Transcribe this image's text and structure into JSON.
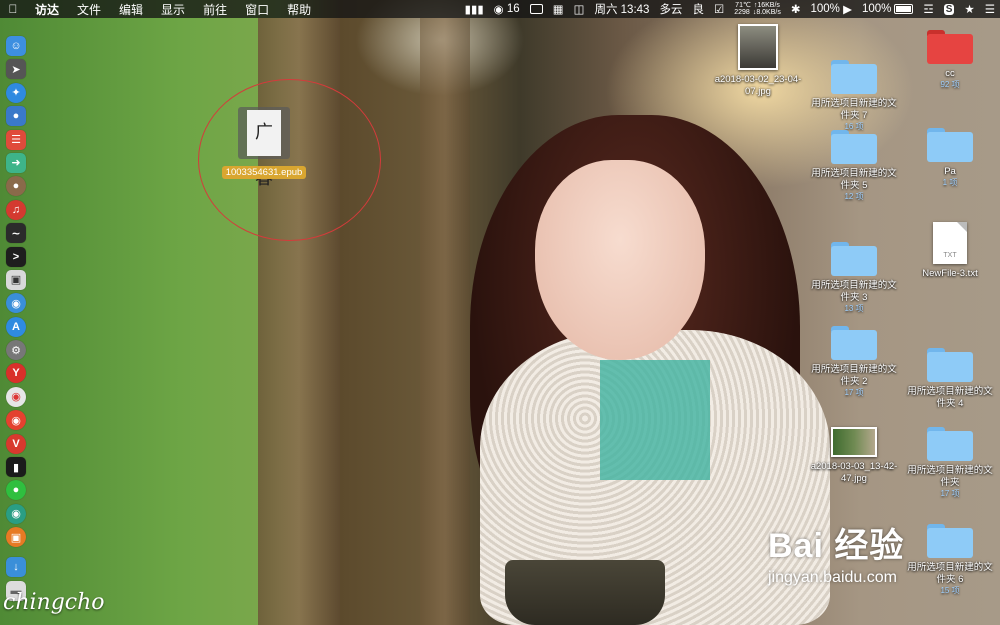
{
  "menubar": {
    "app_name": "访达",
    "menus": [
      "文件",
      "编辑",
      "显示",
      "前往",
      "窗口",
      "帮助"
    ],
    "status": {
      "wechat_count": "16",
      "datetime": "周六 13:43",
      "weather": "多云",
      "quality": "良",
      "temperature": "71℃",
      "net_up": "↑16KB/s",
      "fan": "2298",
      "net_down": "↓8.0KB/s",
      "volume": "100%",
      "battery": "100%"
    }
  },
  "desktop": {
    "epub": {
      "label": "1003354631.epub",
      "cover_text": "广春"
    },
    "jpg1": {
      "label": "a2018-03-02_23-04-07.jpg"
    },
    "jpg2": {
      "label": "a2018-03-03_13-42-47.jpg"
    },
    "folders": [
      {
        "name": "cc",
        "count": "92 项",
        "color": "red"
      },
      {
        "name": "用所选项目新建的文件夹 7",
        "count": "16 项",
        "color": "blue"
      },
      {
        "name": "Pa",
        "count": "1 项",
        "color": "blue"
      },
      {
        "name": "用所选项目新建的文件夹 5",
        "count": "12 项",
        "color": "blue"
      },
      {
        "name": "用所选项目新建的文件夹 3",
        "count": "13 项",
        "color": "blue"
      },
      {
        "name": "用所选项目新建的文件夹 2",
        "count": "17 项",
        "color": "blue"
      },
      {
        "name": "用所选项目新建的文件夹 4",
        "count": "",
        "color": "blue"
      },
      {
        "name": "用所选项目新建的文件夹",
        "count": "17 项",
        "color": "blue"
      },
      {
        "name": "用所选项目新建的文件夹 6",
        "count": "15 项",
        "color": "blue"
      }
    ],
    "txt": {
      "name": "NewFile-3.txt",
      "badge": "TXT"
    }
  },
  "dock": [
    {
      "name": "finder",
      "color": "#3d8fe0"
    },
    {
      "name": "launchpad",
      "color": "#555"
    },
    {
      "name": "safari",
      "color": "#2f8ae0"
    },
    {
      "name": "contacts",
      "color": "#3a79c9"
    },
    {
      "name": "calendar",
      "color": "#e04b3b"
    },
    {
      "name": "migration",
      "color": "#3eb489"
    },
    {
      "name": "photos-app",
      "color": "#8a6a4a"
    },
    {
      "name": "netease",
      "color": "#d43a30"
    },
    {
      "name": "activity",
      "color": "#2b2b2b"
    },
    {
      "name": "terminal",
      "color": "#1e1e1e"
    },
    {
      "name": "preview",
      "color": "#d9d9d9"
    },
    {
      "name": "siri",
      "color": "#3a8fd9"
    },
    {
      "name": "app-store",
      "color": "#2f8be0"
    },
    {
      "name": "system-preferences",
      "color": "#777"
    },
    {
      "name": "yandex",
      "color": "#d9302a"
    },
    {
      "name": "chrome",
      "color": "#e6e6e6"
    },
    {
      "name": "weibo",
      "color": "#e4412f"
    },
    {
      "name": "vivaldi",
      "color": "#d8392e"
    },
    {
      "name": "iterm",
      "color": "#1b1b1b"
    },
    {
      "name": "wechat",
      "color": "#2fbf3f"
    },
    {
      "name": "screenshot",
      "color": "#2a9e84"
    },
    {
      "name": "books",
      "color": "#e77a24"
    },
    {
      "name": "downloads",
      "color": "#3a8fd9"
    },
    {
      "name": "trash",
      "color": "#dcdcdc"
    }
  ],
  "watermark": {
    "signature": "chingcho",
    "baidu_logo": "Bai 经验",
    "baidu_url": "jingyan.baidu.com"
  }
}
